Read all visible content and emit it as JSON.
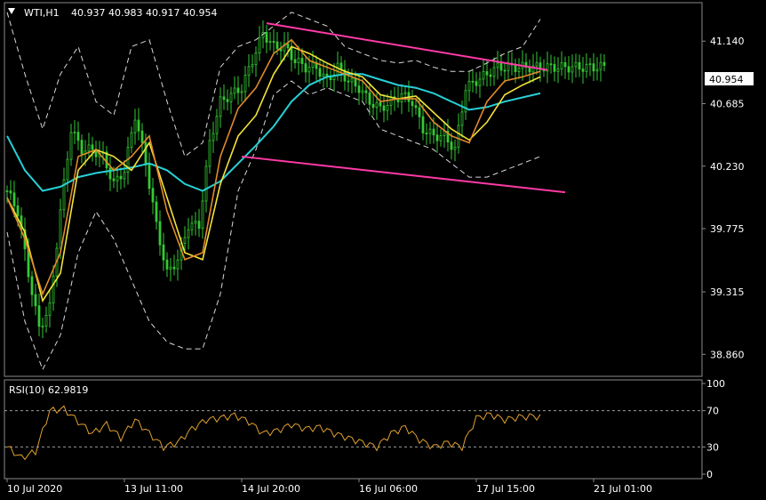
{
  "header": {
    "symbol": "WTI,H1",
    "ohlc": "40.937 40.983 40.917 40.954"
  },
  "current_price": "40.954",
  "rsi_label": "RSI(10) 62.9819",
  "colors": {
    "background": "#000000",
    "candle": "#35c935",
    "ma_fast": "#e08a2c",
    "ma_mid": "#f2e23a",
    "ma_slow": "#27d0d6",
    "bands": "#d9d9d9",
    "trendline": "#ff3aa6",
    "rsi": "#e0a030",
    "price_tag_bg": "#ffffff"
  },
  "chart_data": [
    {
      "type": "line",
      "subtype": "candlestick",
      "x_tick_labels": [
        "10 Jul 2020",
        "13 Jul 11:00",
        "14 Jul 20:00",
        "16 Jul 06:00",
        "17 Jul 15:00",
        "21 Jul 01:00"
      ],
      "y_tick_labels": [
        "41.140",
        "40.685",
        "40.230",
        "39.775",
        "39.315",
        "38.860"
      ],
      "ylim": [
        38.7,
        41.42
      ],
      "series": [
        {
          "name": "",
          "role": "price",
          "x": [
            0,
            3,
            6,
            9,
            12,
            15,
            18,
            21,
            24,
            27,
            30,
            33,
            36,
            39,
            42,
            45,
            48,
            51,
            54,
            57,
            60,
            63,
            66,
            69,
            72,
            75,
            78,
            81,
            84,
            87,
            90,
            93,
            96,
            99,
            102,
            105,
            108,
            111,
            114,
            117,
            120,
            123,
            126,
            129,
            132,
            135,
            138,
            141,
            144,
            147,
            150,
            153,
            156,
            159,
            162,
            165,
            168
          ],
          "y": [
            40.05,
            39.9,
            39.45,
            39.05,
            39.2,
            39.9,
            40.5,
            40.35,
            40.35,
            40.3,
            40.1,
            40.2,
            40.6,
            40.25,
            39.8,
            39.45,
            39.55,
            39.8,
            39.8,
            40.4,
            40.7,
            40.75,
            40.8,
            41.0,
            41.2,
            41.1,
            41.1,
            41.0,
            40.95,
            40.95,
            40.85,
            40.95,
            40.85,
            40.8,
            40.7,
            40.65,
            40.7,
            40.75,
            40.7,
            40.5,
            40.45,
            40.45,
            40.35,
            40.8,
            40.85,
            40.9,
            40.95,
            40.95,
            40.95,
            40.95,
            40.95,
            40.95,
            40.95,
            40.95,
            40.95,
            40.95,
            40.954
          ]
        },
        {
          "name": "",
          "role": "ma_fast",
          "x": [
            0,
            5,
            10,
            15,
            20,
            25,
            30,
            35,
            40,
            45,
            50,
            55,
            60,
            65,
            70,
            75,
            80,
            85,
            90,
            95,
            100,
            105,
            110,
            115,
            120,
            125,
            130,
            135,
            140,
            145,
            150
          ],
          "y": [
            40.0,
            39.7,
            39.3,
            39.6,
            40.3,
            40.35,
            40.2,
            40.3,
            40.45,
            39.9,
            39.55,
            39.6,
            40.3,
            40.65,
            40.8,
            41.05,
            41.15,
            41.0,
            40.95,
            40.9,
            40.85,
            40.7,
            40.72,
            40.72,
            40.55,
            40.45,
            40.4,
            40.7,
            40.85,
            40.88,
            40.92
          ]
        },
        {
          "name": "",
          "role": "ma_mid",
          "x": [
            0,
            5,
            10,
            15,
            20,
            25,
            30,
            35,
            40,
            45,
            50,
            55,
            60,
            65,
            70,
            75,
            80,
            85,
            90,
            95,
            100,
            105,
            110,
            115,
            120,
            125,
            130,
            135,
            140,
            145,
            150
          ],
          "y": [
            40.0,
            39.75,
            39.25,
            39.45,
            40.2,
            40.35,
            40.3,
            40.2,
            40.4,
            40.0,
            39.6,
            39.55,
            40.1,
            40.45,
            40.6,
            40.9,
            41.1,
            41.05,
            40.98,
            40.92,
            40.88,
            40.75,
            40.72,
            40.74,
            40.62,
            40.5,
            40.42,
            40.55,
            40.75,
            40.82,
            40.88
          ]
        },
        {
          "name": "",
          "role": "ma_slow",
          "x": [
            0,
            5,
            10,
            15,
            20,
            25,
            30,
            35,
            40,
            45,
            50,
            55,
            60,
            65,
            70,
            75,
            80,
            85,
            90,
            95,
            100,
            105,
            110,
            115,
            120,
            125,
            130,
            135,
            140,
            145,
            150
          ],
          "y": [
            40.45,
            40.2,
            40.05,
            40.08,
            40.15,
            40.18,
            40.2,
            40.22,
            40.25,
            40.2,
            40.1,
            40.05,
            40.12,
            40.25,
            40.38,
            40.52,
            40.7,
            40.82,
            40.88,
            40.9,
            40.9,
            40.86,
            40.82,
            40.8,
            40.76,
            40.7,
            40.64,
            40.66,
            40.7,
            40.73,
            40.76
          ]
        },
        {
          "name": "",
          "role": "band_upper",
          "x": [
            0,
            5,
            10,
            15,
            20,
            25,
            30,
            35,
            40,
            45,
            50,
            55,
            60,
            65,
            70,
            75,
            80,
            85,
            90,
            95,
            100,
            105,
            110,
            115,
            120,
            125,
            130,
            135,
            140,
            145,
            150
          ],
          "y": [
            41.35,
            40.9,
            40.5,
            40.9,
            41.1,
            40.7,
            40.6,
            41.1,
            41.15,
            40.7,
            40.3,
            40.4,
            40.95,
            41.1,
            41.15,
            41.25,
            41.35,
            41.3,
            41.25,
            41.1,
            41.05,
            41.0,
            40.98,
            41.0,
            40.95,
            40.92,
            40.92,
            40.98,
            41.05,
            41.1,
            41.3
          ]
        },
        {
          "name": "",
          "role": "band_lower",
          "x": [
            0,
            5,
            10,
            15,
            20,
            25,
            30,
            35,
            40,
            45,
            50,
            55,
            60,
            65,
            70,
            75,
            80,
            85,
            90,
            95,
            100,
            105,
            110,
            115,
            120,
            125,
            130,
            135,
            140,
            145,
            150
          ],
          "y": [
            39.75,
            39.1,
            38.75,
            39.0,
            39.6,
            39.9,
            39.7,
            39.4,
            39.1,
            38.95,
            38.9,
            38.9,
            39.3,
            40.05,
            40.35,
            40.75,
            40.85,
            40.75,
            40.8,
            40.75,
            40.7,
            40.5,
            40.45,
            40.4,
            40.35,
            40.25,
            40.15,
            40.15,
            40.2,
            40.25,
            40.3
          ]
        },
        {
          "name": "",
          "role": "trendline_upper",
          "x": [
            73,
            152
          ],
          "y": [
            41.27,
            40.93
          ]
        },
        {
          "name": "",
          "role": "trendline_lower",
          "x": [
            66,
            157
          ],
          "y": [
            40.3,
            40.04
          ]
        }
      ]
    },
    {
      "type": "line",
      "y_tick_labels": [
        "100",
        "70",
        "30",
        "0"
      ],
      "ylim": [
        0,
        100
      ],
      "levels": [
        70,
        30
      ],
      "series": [
        {
          "name": "",
          "role": "rsi",
          "x": [
            0,
            4,
            8,
            12,
            16,
            20,
            24,
            28,
            32,
            36,
            40,
            44,
            48,
            52,
            56,
            60,
            64,
            68,
            72,
            76,
            80,
            84,
            88,
            92,
            96,
            100,
            104,
            108,
            112,
            116,
            120,
            124,
            128,
            132,
            136,
            140,
            144,
            148,
            150
          ],
          "y": [
            30,
            18,
            25,
            70,
            72,
            58,
            45,
            55,
            40,
            60,
            45,
            30,
            35,
            50,
            60,
            62,
            65,
            58,
            45,
            48,
            55,
            50,
            52,
            45,
            40,
            35,
            30,
            45,
            52,
            38,
            30,
            35,
            30,
            62,
            66,
            60,
            63,
            64,
            63
          ]
        }
      ]
    }
  ]
}
